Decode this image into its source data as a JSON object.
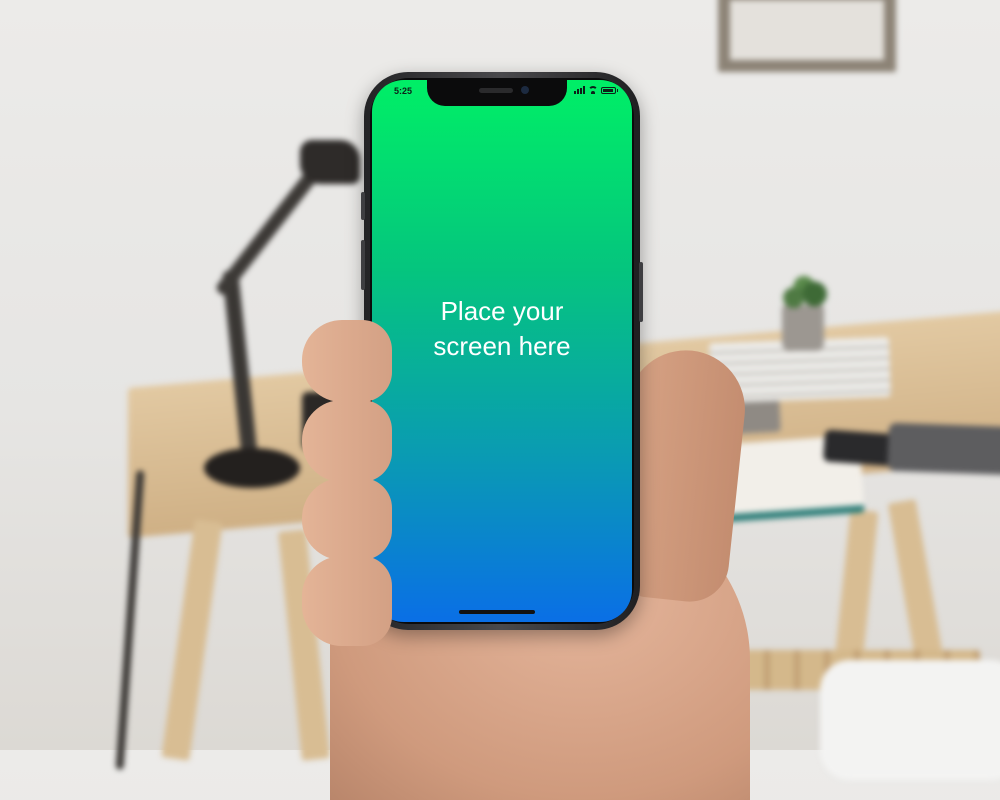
{
  "status_bar": {
    "time": "5:25",
    "icons": [
      "signal-icon",
      "wifi-icon",
      "battery-icon"
    ]
  },
  "screen": {
    "line1": "Place your",
    "line2": "screen here",
    "gradient_top": "#00ef66",
    "gradient_bottom": "#0a6fe6"
  },
  "scene": {
    "device": "phone-mockup-held-in-hand",
    "background": "blurred-desk-scene"
  }
}
